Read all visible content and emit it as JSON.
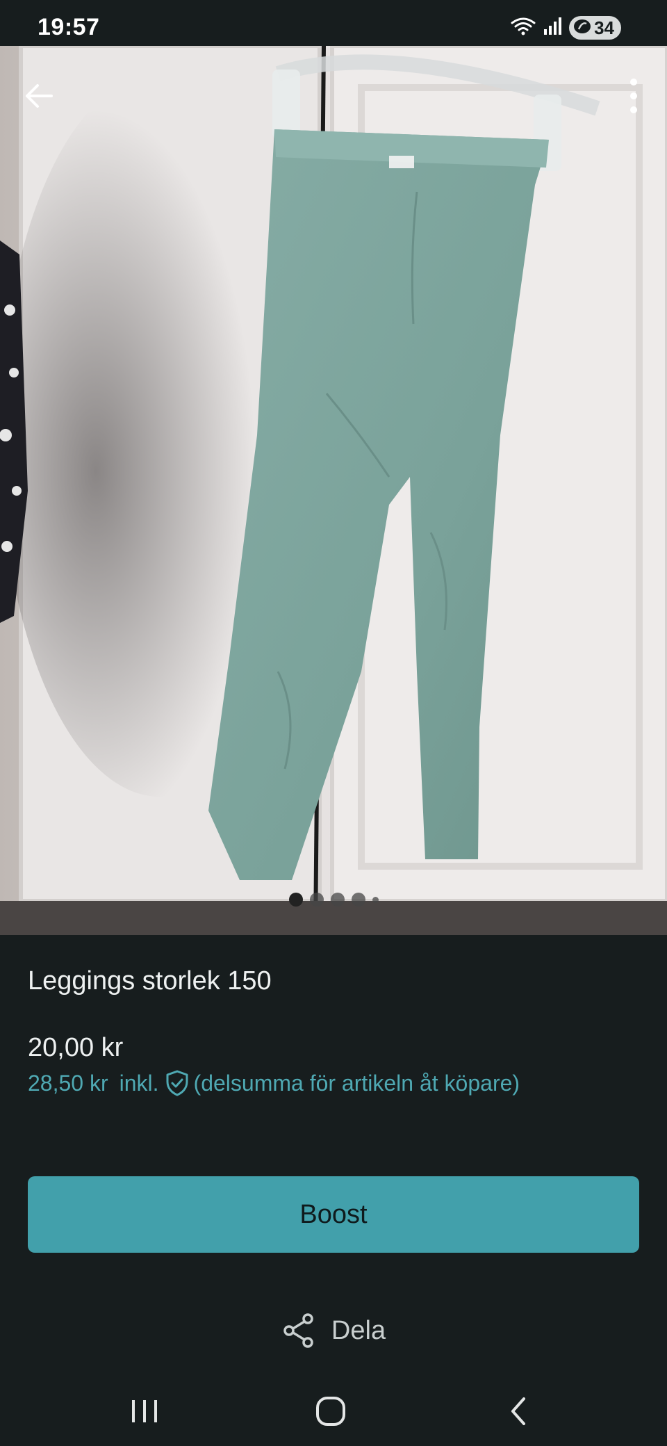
{
  "status_bar": {
    "time": "19:57",
    "battery": "34",
    "icons": [
      "wifi-icon",
      "signal-icon",
      "battery-saver-icon"
    ]
  },
  "photo": {
    "image_count": 5,
    "active_index": 0
  },
  "listing": {
    "title": "Leggings storlek 150",
    "price": "20,00 kr",
    "price_incl_amount": "28,50 kr",
    "price_incl_text": "inkl.",
    "price_incl_note": "(delsumma för artikeln åt köpare)"
  },
  "actions": {
    "boost_label": "Boost",
    "share_label": "Dela"
  },
  "colors": {
    "background": "#171d1e",
    "accent": "#42a0ab",
    "accent_text": "#4fa9b3"
  }
}
